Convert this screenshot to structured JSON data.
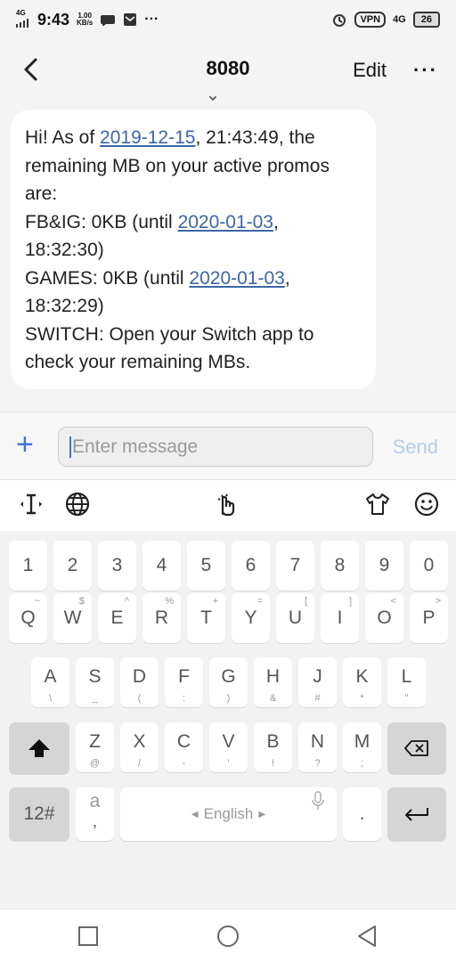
{
  "status": {
    "net_left": "4G",
    "time": "9:43",
    "speed_top": "1.00",
    "speed_bottom": "KB/s",
    "dots": "···",
    "vpn": "VPN",
    "net_right": "4G",
    "battery": "26"
  },
  "header": {
    "title": "8080",
    "edit": "Edit",
    "more": "···"
  },
  "message": {
    "prefix": "Hi! As of ",
    "date1": "2019-12-15",
    "time1": ", 21:43:49, the remaining MB on your active promos are:",
    "fbig_prefix": "FB&IG: 0KB (until ",
    "date2": "2020-01-03",
    "fbig_suffix": ", 18:32:30)",
    "games_prefix": "GAMES: 0KB (until ",
    "date3": "2020-01-03",
    "games_suffix": ", 18:32:29)",
    "switch": "SWITCH: Open your Switch app to check your remaining MBs."
  },
  "composer": {
    "placeholder": "Enter message",
    "send": "Send"
  },
  "keyboard": {
    "row1": [
      "1",
      "2",
      "3",
      "4",
      "5",
      "6",
      "7",
      "8",
      "9",
      "0"
    ],
    "row2": [
      "Q",
      "W",
      "E",
      "R",
      "T",
      "Y",
      "U",
      "I",
      "O",
      "P"
    ],
    "row2_sub": [
      "~",
      "$",
      "^",
      "%",
      "+",
      "=",
      "[",
      "]",
      "<",
      ">"
    ],
    "row3": [
      "A",
      "S",
      "D",
      "F",
      "G",
      "H",
      "J",
      "K",
      "L"
    ],
    "row3_sub": [
      "\\",
      "_",
      "(",
      ":",
      ")",
      "&",
      "#",
      "*",
      "\""
    ],
    "row4": [
      "Z",
      "X",
      "C",
      "V",
      "B",
      "N",
      "M"
    ],
    "row4_sub": [
      "@",
      "/",
      "-",
      "'",
      "!",
      "?",
      ";"
    ],
    "mode": "12#",
    "a_top": "a",
    "a_bottom": ",",
    "space": "English",
    "period": "."
  }
}
